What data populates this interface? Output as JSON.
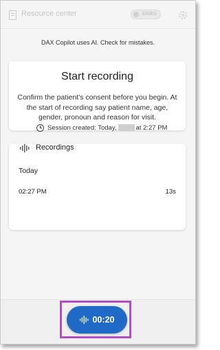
{
  "header": {
    "title": "Resource center",
    "lang_toggle": "EN/ES"
  },
  "ai_note": "DAX Copilot uses AI. Check for mistakes.",
  "start_card": {
    "heading": "Start recording",
    "instructions": "Confirm the patient's consent before you begin. At the start of recording say patient name, age, gender, pronoun and reason for visit."
  },
  "session": {
    "prefix": "Session created: Today,",
    "suffix": "at 2:27 PM"
  },
  "recordings": {
    "title": "Recordings",
    "group_label": "Today",
    "items": [
      {
        "time": "02:27 PM",
        "duration": "13s"
      }
    ]
  },
  "timer": {
    "label": "00:20"
  },
  "colors": {
    "accent": "#1e6ac6",
    "highlight": "#b24fc6"
  }
}
